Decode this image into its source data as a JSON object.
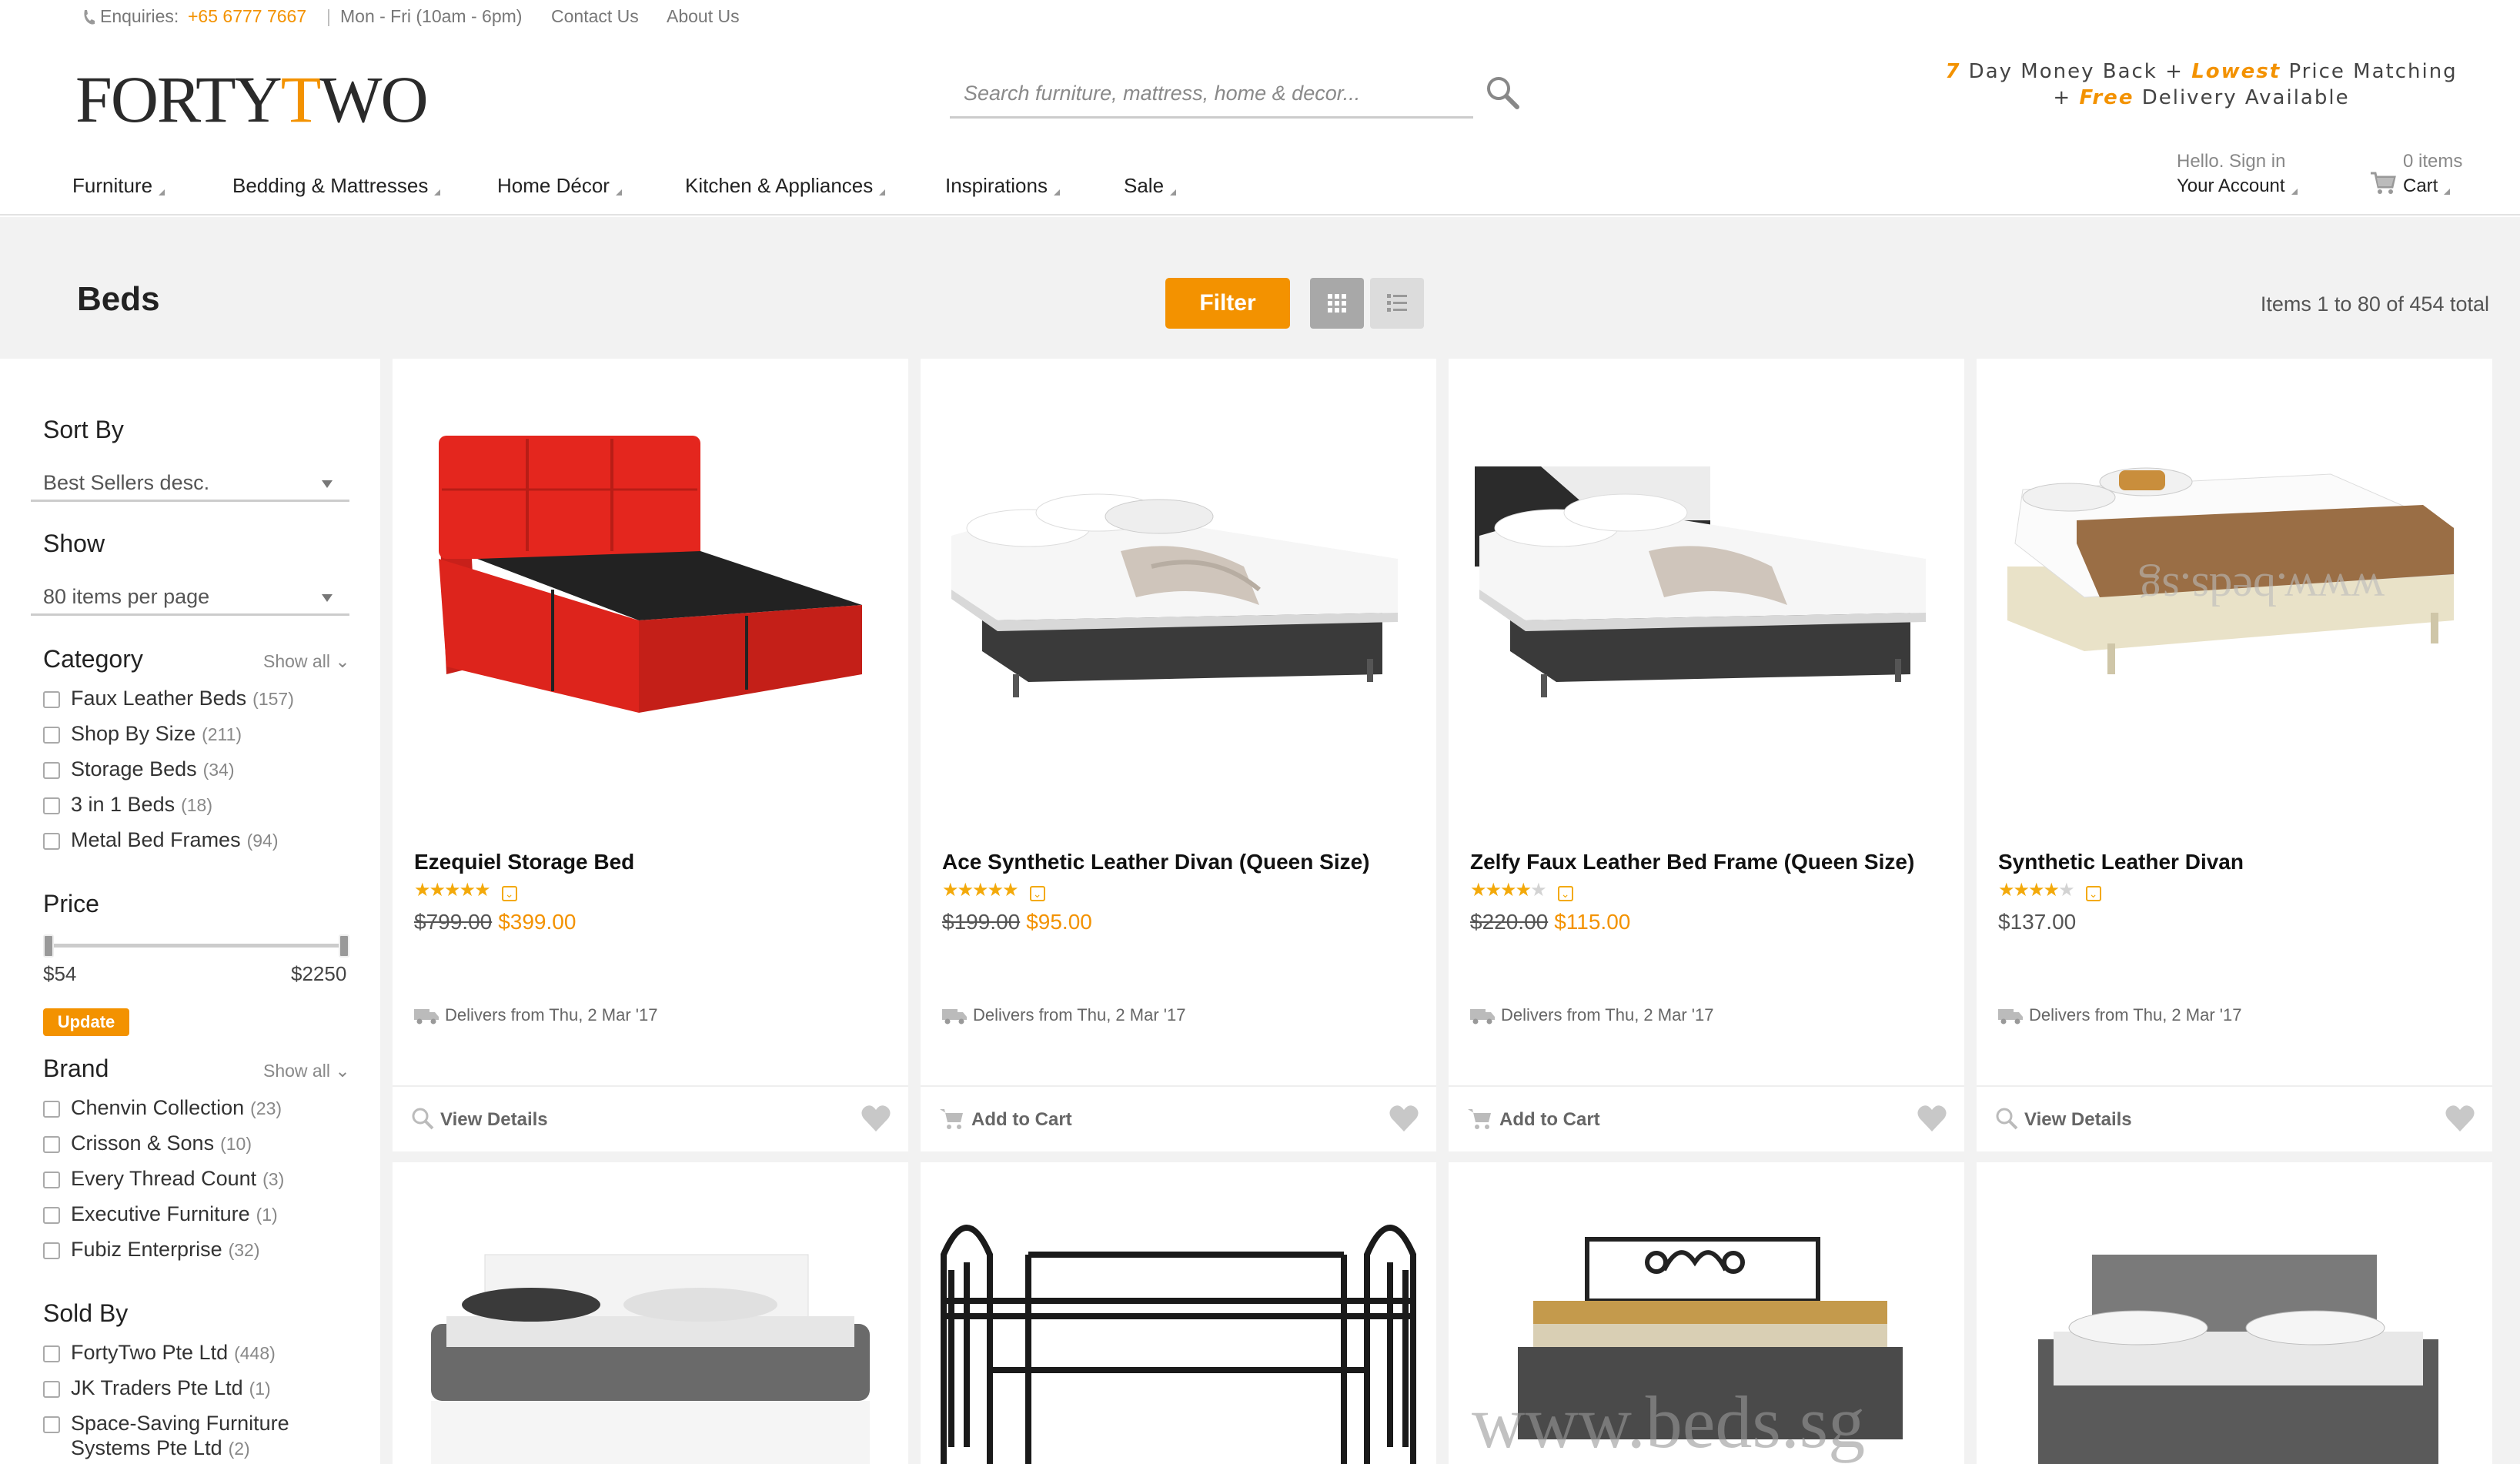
{
  "topbar": {
    "enquiries_label": "Enquiries:",
    "phone": "+65 6777 7667",
    "separator": "|",
    "hours": "Mon - Fri (10am - 6pm)",
    "contact": "Contact Us",
    "about": "About Us"
  },
  "header": {
    "logo_part1": "FORTY",
    "logo_t": "T",
    "logo_part2": "WO",
    "search_placeholder": "Search furniture, mattress, home & decor...",
    "promo": {
      "num": "7",
      "t1": " Day Money Back + ",
      "lowest": "Lowest",
      "t2": " Price Matching",
      "plus": "+ ",
      "free": "Free",
      "t3": " Delivery Available"
    }
  },
  "nav": {
    "items": [
      "Furniture",
      "Bedding & Mattresses",
      "Home Décor",
      "Kitchen & Appliances",
      "Inspirations",
      "Sale"
    ],
    "account_small": "Hello. Sign in",
    "account_big": "Your Account",
    "cart_small": "0 items",
    "cart_big": "Cart"
  },
  "toolbar": {
    "page_title": "Beds",
    "filter_label": "Filter",
    "items_total": "Items 1 to 80 of 454 total"
  },
  "sidebar": {
    "sort_title": "Sort By",
    "sort_value": "Best Sellers desc.",
    "show_title": "Show",
    "show_value": "80 items per page",
    "category_title": "Category",
    "category_show_all": "Show all",
    "categories": [
      {
        "label": "Faux Leather Beds",
        "count": "(157)"
      },
      {
        "label": "Shop By Size",
        "count": "(211)"
      },
      {
        "label": "Storage Beds",
        "count": "(34)"
      },
      {
        "label": "3 in 1 Beds",
        "count": "(18)"
      },
      {
        "label": "Metal Bed Frames",
        "count": "(94)"
      }
    ],
    "price_title": "Price",
    "price_min": "$54",
    "price_max": "$2250",
    "update_label": "Update",
    "brand_title": "Brand",
    "brand_show_all": "Show all",
    "brands": [
      {
        "label": "Chenvin Collection",
        "count": "(23)"
      },
      {
        "label": "Crisson & Sons",
        "count": "(10)"
      },
      {
        "label": "Every Thread Count",
        "count": "(3)"
      },
      {
        "label": "Executive Furniture",
        "count": "(1)"
      },
      {
        "label": "Fubiz Enterprise",
        "count": "(32)"
      }
    ],
    "sold_title": "Sold By",
    "sellers": [
      {
        "label": "FortyTwo Pte Ltd",
        "count": "(448)"
      },
      {
        "label": "JK Traders Pte Ltd",
        "count": "(1)"
      },
      {
        "label": "Space-Saving Furniture",
        "count": ""
      },
      {
        "label": "Systems Pte Ltd",
        "count": "(2)"
      }
    ]
  },
  "products": [
    {
      "name": "Ezequiel Storage Bed",
      "rating": 5,
      "old_price": "$799.00",
      "price": "$399.00",
      "delivery": "Delivers from Thu, 2 Mar '17",
      "action": "View Details"
    },
    {
      "name": "Ace Synthetic Leather Divan (Queen Size)",
      "rating": 5,
      "old_price": "$199.00",
      "price": "$95.00",
      "delivery": "Delivers from Thu, 2 Mar '17",
      "action": "Add to Cart"
    },
    {
      "name": "Zelfy Faux Leather Bed Frame (Queen Size)",
      "rating": 4.5,
      "old_price": "$220.00",
      "price": "$115.00",
      "delivery": "Delivers from Thu, 2 Mar '17",
      "action": "Add to Cart"
    },
    {
      "name": "Synthetic Leather Divan",
      "rating": 4.5,
      "old_price": "",
      "price": "$137.00",
      "delivery": "Delivers from Thu, 2 Mar '17",
      "action": "View Details"
    }
  ],
  "watermarks": [
    "www.beds.sg",
    "www.beds.sg"
  ],
  "colors": {
    "accent": "#f39200",
    "star": "#f3a90a",
    "band": "#f2f2f2"
  }
}
